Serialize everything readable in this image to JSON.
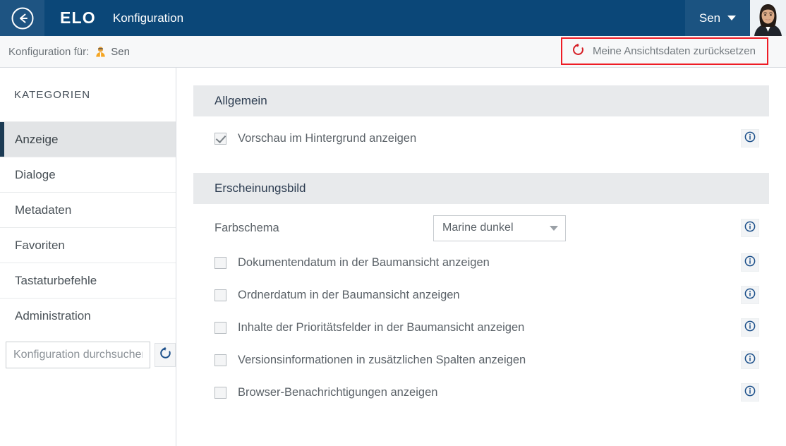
{
  "topbar": {
    "back_icon": "back-arrow-circle-icon",
    "brand": "ELO",
    "title": "Konfiguration",
    "user_name": "Sen",
    "caret_icon": "chevron-down-icon",
    "avatar_icon": "user-avatar-photo",
    "bg_color": "#0b4778",
    "back_cell_color": "#1e5482",
    "user_menu_color": "#1b5381"
  },
  "subheader": {
    "label": "Konfiguration für:",
    "user_icon": "person-icon",
    "user_name": "Sen",
    "reset_banner": {
      "icon": "reset-counterclockwise-icon",
      "label": "Meine Ansichtsdaten zurücksetzen",
      "border_color": "#ee1c25",
      "icon_color": "#d61f26"
    }
  },
  "sidebar": {
    "title": "KATEGORIEN",
    "items": [
      {
        "label": "Anzeige",
        "active": true
      },
      {
        "label": "Dialoge",
        "active": false
      },
      {
        "label": "Metadaten",
        "active": false
      },
      {
        "label": "Favoriten",
        "active": false
      },
      {
        "label": "Tastaturbefehle",
        "active": false
      },
      {
        "label": "Administration",
        "active": false
      }
    ],
    "search": {
      "placeholder": "Konfiguration durchsuchen",
      "value": "",
      "reset_icon": "reset-counterclockwise-icon"
    },
    "active_accent_color": "#1c3b54",
    "active_bg_color": "#e2e4e6"
  },
  "content": {
    "sections": [
      {
        "header": "Allgemein",
        "rows": [
          {
            "kind": "checkbox",
            "label": "Vorschau im Hintergrund anzeigen",
            "checked": true,
            "info_icon": "info-circle-icon"
          }
        ]
      },
      {
        "header": "Erscheinungsbild",
        "rows": [
          {
            "kind": "select",
            "label": "Farbschema",
            "value": "Marine dunkel",
            "caret_icon": "chevron-down-icon",
            "info_icon": "info-circle-icon"
          },
          {
            "kind": "checkbox",
            "label": "Dokumentendatum in der Baumansicht anzeigen",
            "checked": false,
            "info_icon": "info-circle-icon"
          },
          {
            "kind": "checkbox",
            "label": "Ordnerdatum in der Baumansicht anzeigen",
            "checked": false,
            "info_icon": "info-circle-icon"
          },
          {
            "kind": "checkbox",
            "label": "Inhalte der Prioritätsfelder in der Baumansicht anzeigen",
            "checked": false,
            "info_icon": "info-circle-icon"
          },
          {
            "kind": "checkbox",
            "label": "Versionsinformationen in zusätzlichen Spalten anzeigen",
            "checked": false,
            "info_icon": "info-circle-icon"
          },
          {
            "kind": "checkbox",
            "label": "Browser-Benachrichtigungen anzeigen",
            "checked": false,
            "info_icon": "info-circle-icon"
          }
        ]
      }
    ],
    "section_header_bg": "#e8eaec",
    "info_icon_color": "#1b4f8a"
  }
}
